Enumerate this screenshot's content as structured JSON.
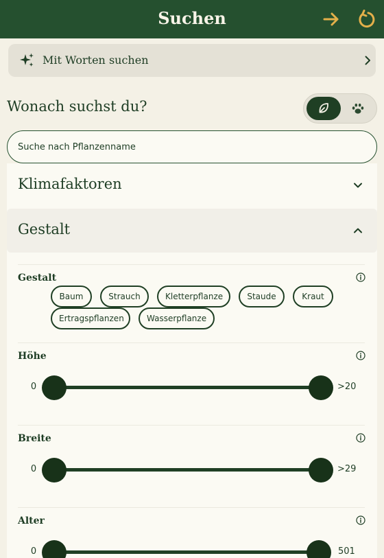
{
  "header": {
    "title": "Suchen",
    "search_icon": "arrow-right-icon",
    "reset_icon": "reset-icon"
  },
  "ai_search": {
    "label": "Mit Worten suchen",
    "icon": "sparkle-icon"
  },
  "section": {
    "title": "Wonach suchst du?",
    "toggle": {
      "selected": "plants",
      "options": [
        "leaf-icon",
        "paw-icon"
      ]
    }
  },
  "search": {
    "placeholder": "Suche nach Pflanzenname",
    "value": ""
  },
  "accordions": {
    "klima": {
      "title": "Klimafaktoren",
      "expanded": false
    },
    "gestalt": {
      "title": "Gestalt",
      "expanded": true
    }
  },
  "gestalt_filter": {
    "label": "Gestalt",
    "chips": [
      "Baum",
      "Strauch",
      "Kletterpflanze",
      "Staude",
      "Kraut",
      "Ertragspflanzen",
      "Wasserpflanze"
    ]
  },
  "sliders": {
    "hoehe": {
      "label": "Höhe",
      "min": "0",
      "max": ">20"
    },
    "breite": {
      "label": "Breite",
      "min": "0",
      "max": ">29"
    },
    "alter": {
      "label": "Alter",
      "min": "0",
      "max": "501"
    }
  },
  "colors": {
    "header_bg": "#25502f",
    "accent": "#e4b04a",
    "dark_green": "#1f3f24",
    "page_bg": "#f4f1e6"
  }
}
